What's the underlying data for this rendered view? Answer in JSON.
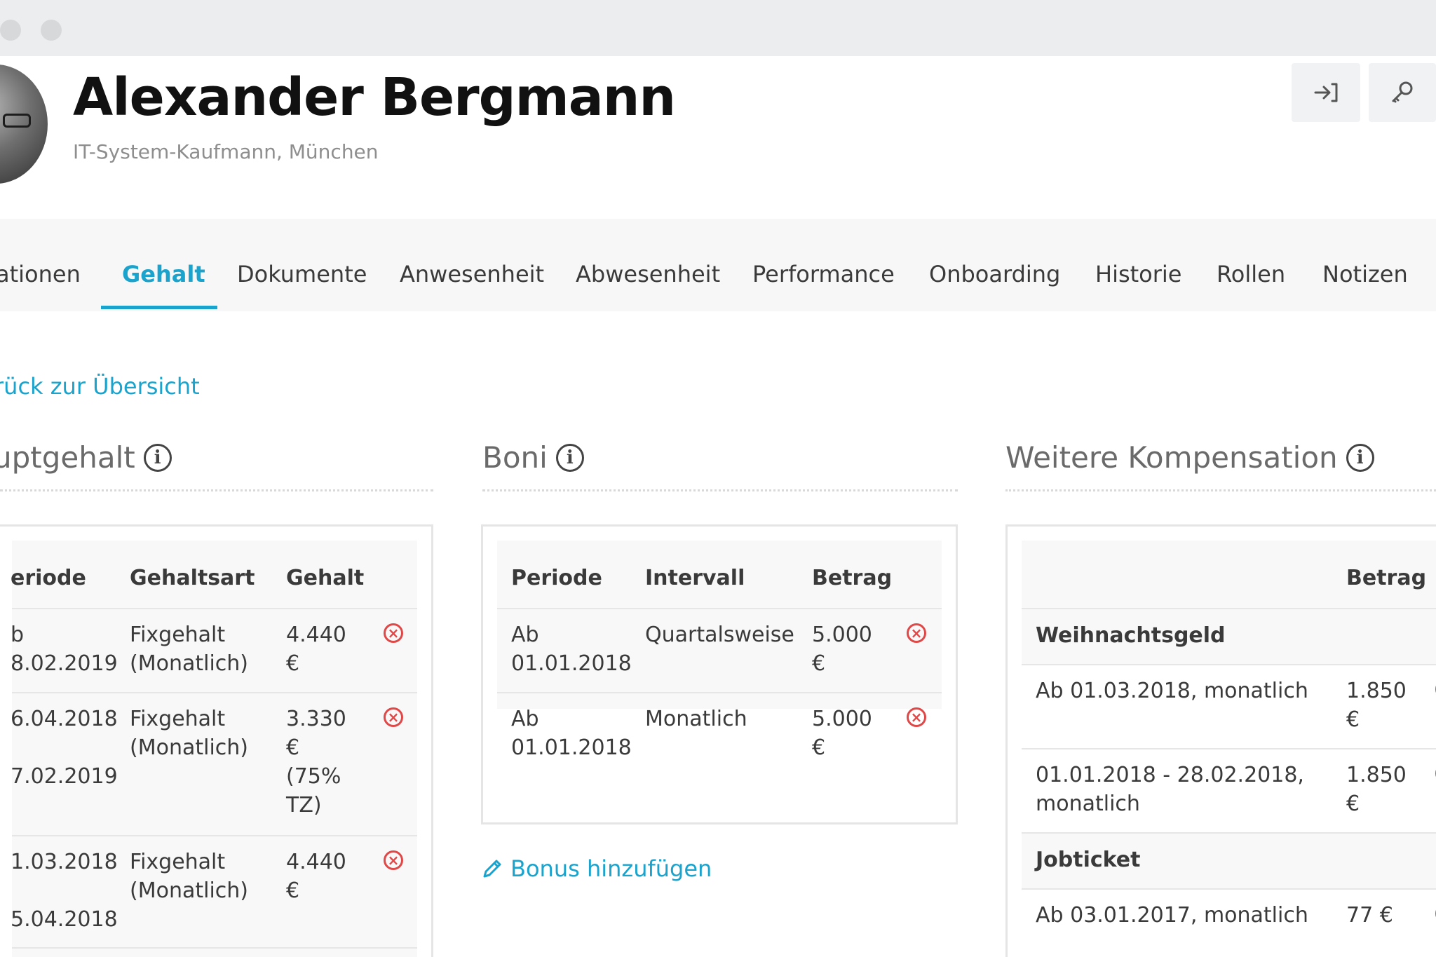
{
  "header": {
    "name": "Alexander Bergmann",
    "subtitle": "IT-System-Kaufmann, München",
    "login_button_icon": "sign-in-icon",
    "key_button_icon": "key-icon"
  },
  "tabs": [
    {
      "label": "ationen"
    },
    {
      "label": "Gehalt",
      "active": true
    },
    {
      "label": "Dokumente"
    },
    {
      "label": "Anwesenheit"
    },
    {
      "label": "Abwesenheit"
    },
    {
      "label": "Performance"
    },
    {
      "label": "Onboarding"
    },
    {
      "label": "Historie"
    },
    {
      "label": "Rollen"
    },
    {
      "label": "Notizen"
    }
  ],
  "back_link": "rück zur Übersicht",
  "hauptgehalt": {
    "title": "uptgehalt",
    "headers": [
      "eriode",
      "Gehaltsart",
      "Gehalt"
    ],
    "rows": [
      {
        "periode": "b\n8.02.2019",
        "art": "Fixgehalt\n(Monatlich)",
        "gehalt": "4.440\n€"
      },
      {
        "periode": "6.04.2018\n\n7.02.2019",
        "art": "Fixgehalt\n(Monatlich)",
        "gehalt": "3.330\n€\n(75%\nTZ)"
      },
      {
        "periode": "1.03.2018\n\n5.04.2018",
        "art": "Fixgehalt\n(Monatlich)",
        "gehalt": "4.440\n€"
      }
    ]
  },
  "boni": {
    "title": "Boni",
    "headers": [
      "Periode",
      "Intervall",
      "Betrag"
    ],
    "rows": [
      {
        "periode": "Ab\n01.01.2018",
        "intervall": "Quartalsweise",
        "betrag": "5.000\n€"
      },
      {
        "periode": "Ab\n01.01.2018",
        "intervall": "Monatlich",
        "betrag": "5.000\n€"
      }
    ],
    "add_label": "Bonus hinzufügen"
  },
  "weitere": {
    "title": "Weitere Kompensation",
    "header_betrag": "Betrag",
    "groups": [
      {
        "name": "Weihnachtsgeld",
        "rows": [
          {
            "periode": "Ab 01.03.2018, monatlich",
            "betrag": "1.850\n€"
          },
          {
            "periode": "01.01.2018 - 28.02.2018,\nmonatlich",
            "betrag": "1.850\n€"
          }
        ]
      },
      {
        "name": "Jobticket",
        "rows": [
          {
            "periode": "Ab 03.01.2017, monatlich",
            "betrag": "77 €"
          }
        ]
      }
    ]
  },
  "colors": {
    "accent": "#1aa3cc",
    "delete": "#e04848",
    "tabs_bg": "#f7f7f8"
  },
  "delete_symbol": "×"
}
